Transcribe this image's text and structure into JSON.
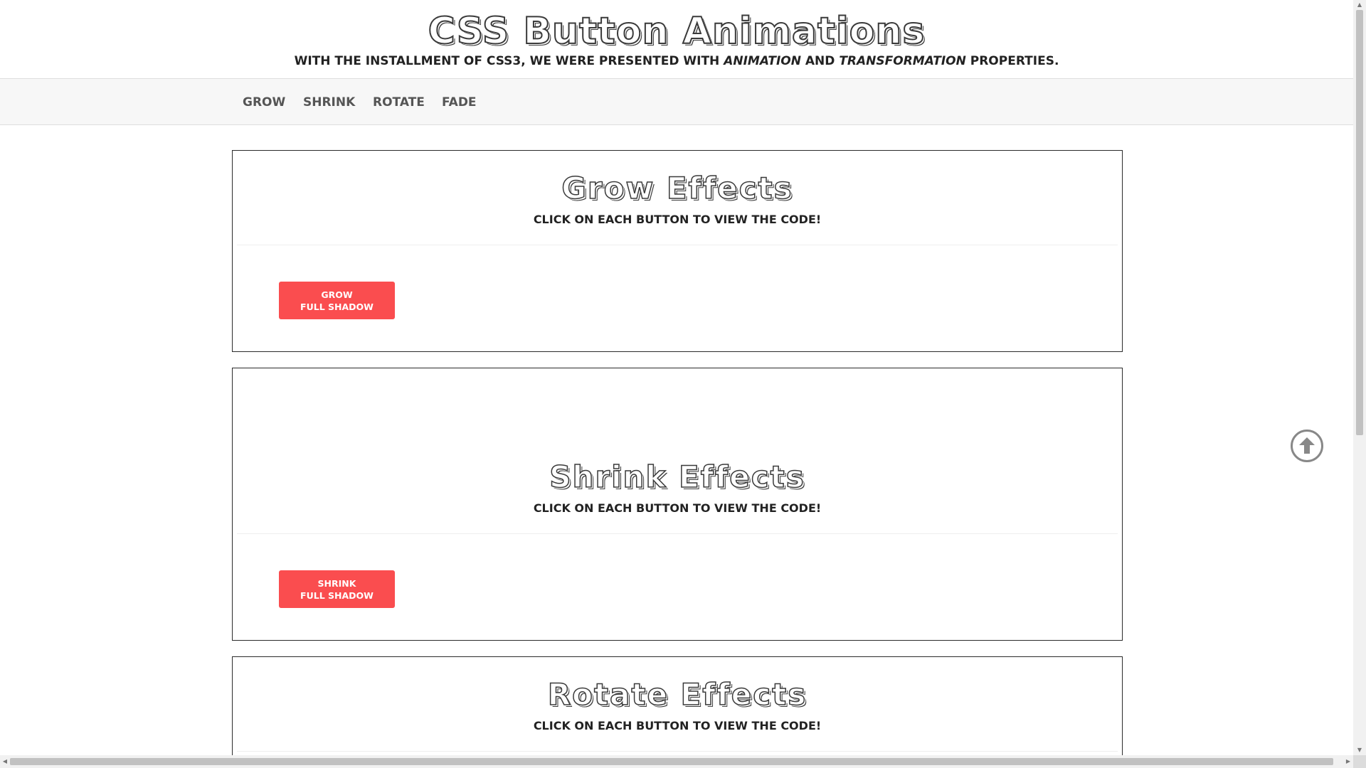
{
  "header": {
    "title": "CSS Button Animations",
    "tagline_prefix": "WITH THE INSTALLMENT OF CSS3, WE WERE PRESENTED WITH ",
    "tagline_em1": "ANIMATION",
    "tagline_mid": " AND ",
    "tagline_em2": "TRANSFORMATION",
    "tagline_suffix": " PROPERTIES."
  },
  "nav": {
    "items": [
      {
        "label": "GROW"
      },
      {
        "label": "SHRINK"
      },
      {
        "label": "ROTATE"
      },
      {
        "label": "FADE"
      }
    ]
  },
  "sections": [
    {
      "title": "Grow Effects",
      "subtitle": "CLICK ON EACH BUTTON TO VIEW THE CODE!",
      "button": {
        "line1": "GROW",
        "line2": "FULL SHADOW"
      }
    },
    {
      "title": "Shrink Effects",
      "subtitle": "CLICK ON EACH BUTTON TO VIEW THE CODE!",
      "button": {
        "line1": "SHRINK",
        "line2": "FULL SHADOW"
      }
    },
    {
      "title": "Rotate Effects",
      "subtitle": "CLICK ON EACH BUTTON TO VIEW THE CODE!"
    }
  ],
  "colors": {
    "accent": "#fa4d4f",
    "nav_background": "#f7f7f7",
    "nav_text": "#555555"
  },
  "icons": {
    "scroll_top": "arrow-circle-up-icon"
  }
}
